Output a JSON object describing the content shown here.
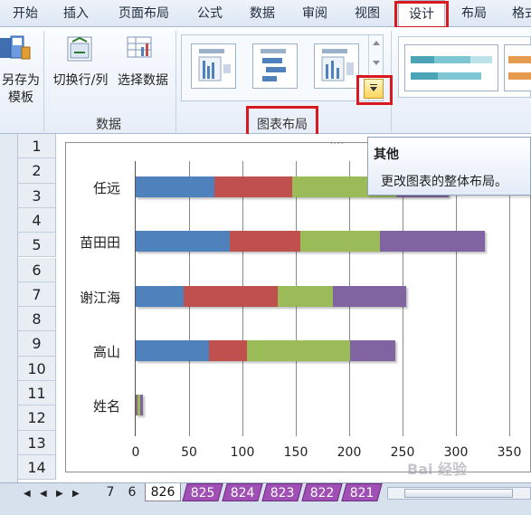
{
  "ribbon": {
    "tabs": [
      "开始",
      "插入",
      "页面布局",
      "公式",
      "数据",
      "审阅",
      "视图",
      "设计",
      "布局",
      "格式"
    ],
    "active_tab": "设计",
    "buttons": {
      "save_as_template_1": "另存为",
      "save_as_template_2": "模板",
      "switch_row_col": "切换行/列",
      "select_data": "选择数据"
    },
    "groups": {
      "data": "数据",
      "chart_layouts": "图表布局"
    },
    "style_colors": [
      "#4ba3b8",
      "#7fc6d4",
      "#e59a4f"
    ]
  },
  "tooltip": {
    "title": "其他",
    "description": "更改图表的整体布局。"
  },
  "rows": [
    "1",
    "2",
    "3",
    "4",
    "5",
    "6",
    "7",
    "8",
    "9",
    "10",
    "11",
    "12",
    "13",
    "14"
  ],
  "sheet_tabs": {
    "tabs": [
      "7",
      "6",
      "826",
      "825",
      "824",
      "823",
      "822",
      "821"
    ],
    "active": "826"
  },
  "watermark": "Bai 经验",
  "chart_data": {
    "type": "bar",
    "orientation": "horizontal",
    "stacked": true,
    "categories": [
      "任远",
      "苗田田",
      "谢江海",
      "高山",
      "姓名"
    ],
    "series": [
      {
        "values": [
          74,
          88,
          45,
          69,
          1
        ],
        "color": "#4f81bd"
      },
      {
        "values": [
          73,
          66,
          88,
          35,
          1
        ],
        "color": "#c0504d"
      },
      {
        "values": [
          97,
          75,
          52,
          97,
          2
        ],
        "color": "#9bbb59"
      },
      {
        "values": [
          49,
          98,
          68,
          42,
          3
        ],
        "color": "#8064a2"
      }
    ],
    "x_ticks": [
      0,
      50,
      100,
      150,
      200,
      250,
      300,
      350
    ],
    "xlim": [
      0,
      350
    ],
    "grid": true,
    "legend": "none"
  }
}
